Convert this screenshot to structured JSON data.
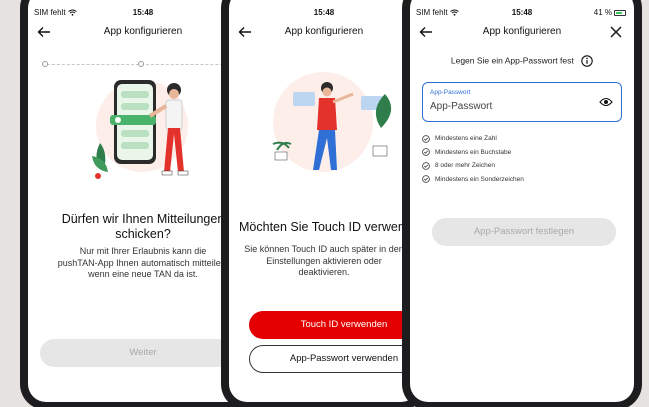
{
  "status": {
    "carrier": "SIM fehlt",
    "time": "15:48",
    "battery": "41 %"
  },
  "nav": {
    "title": "App konfigurieren"
  },
  "screen1": {
    "heading_line1": "Dürfen wir Ihnen Mitteilungen",
    "heading_line2": "schicken?",
    "body_line1": "Nur mit Ihrer Erlaubnis kann die",
    "body_line2": "pushTAN-App Ihnen automatisch mitteilen,",
    "body_line3": "wenn eine neue TAN da ist.",
    "button": "Weiter"
  },
  "screen2": {
    "heading": "Möchten Sie Touch ID verwenden?",
    "body_line1": "Sie können Touch ID auch später in den",
    "body_line2": "Einstellungen aktivieren oder",
    "body_line3": "deaktivieren.",
    "primary_button": "Touch ID verwenden",
    "secondary_button": "App-Passwort verwenden"
  },
  "screen3": {
    "info": "Legen Sie ein App-Passwort fest",
    "field_label": "App-Passwort",
    "field_value": "App-Passwort",
    "rules": [
      "Mindestens eine Zahl",
      "Mindestens ein Buchstabe",
      "8 oder mehr Zeichen",
      "Mindestens ein Sonderzeichen"
    ],
    "button": "App-Passwort festlegen"
  },
  "colors": {
    "accent_red": "#e40000",
    "field_blue": "#2f6fd6",
    "disabled_gray": "#e6e6e6",
    "background": "#e5e2df"
  }
}
